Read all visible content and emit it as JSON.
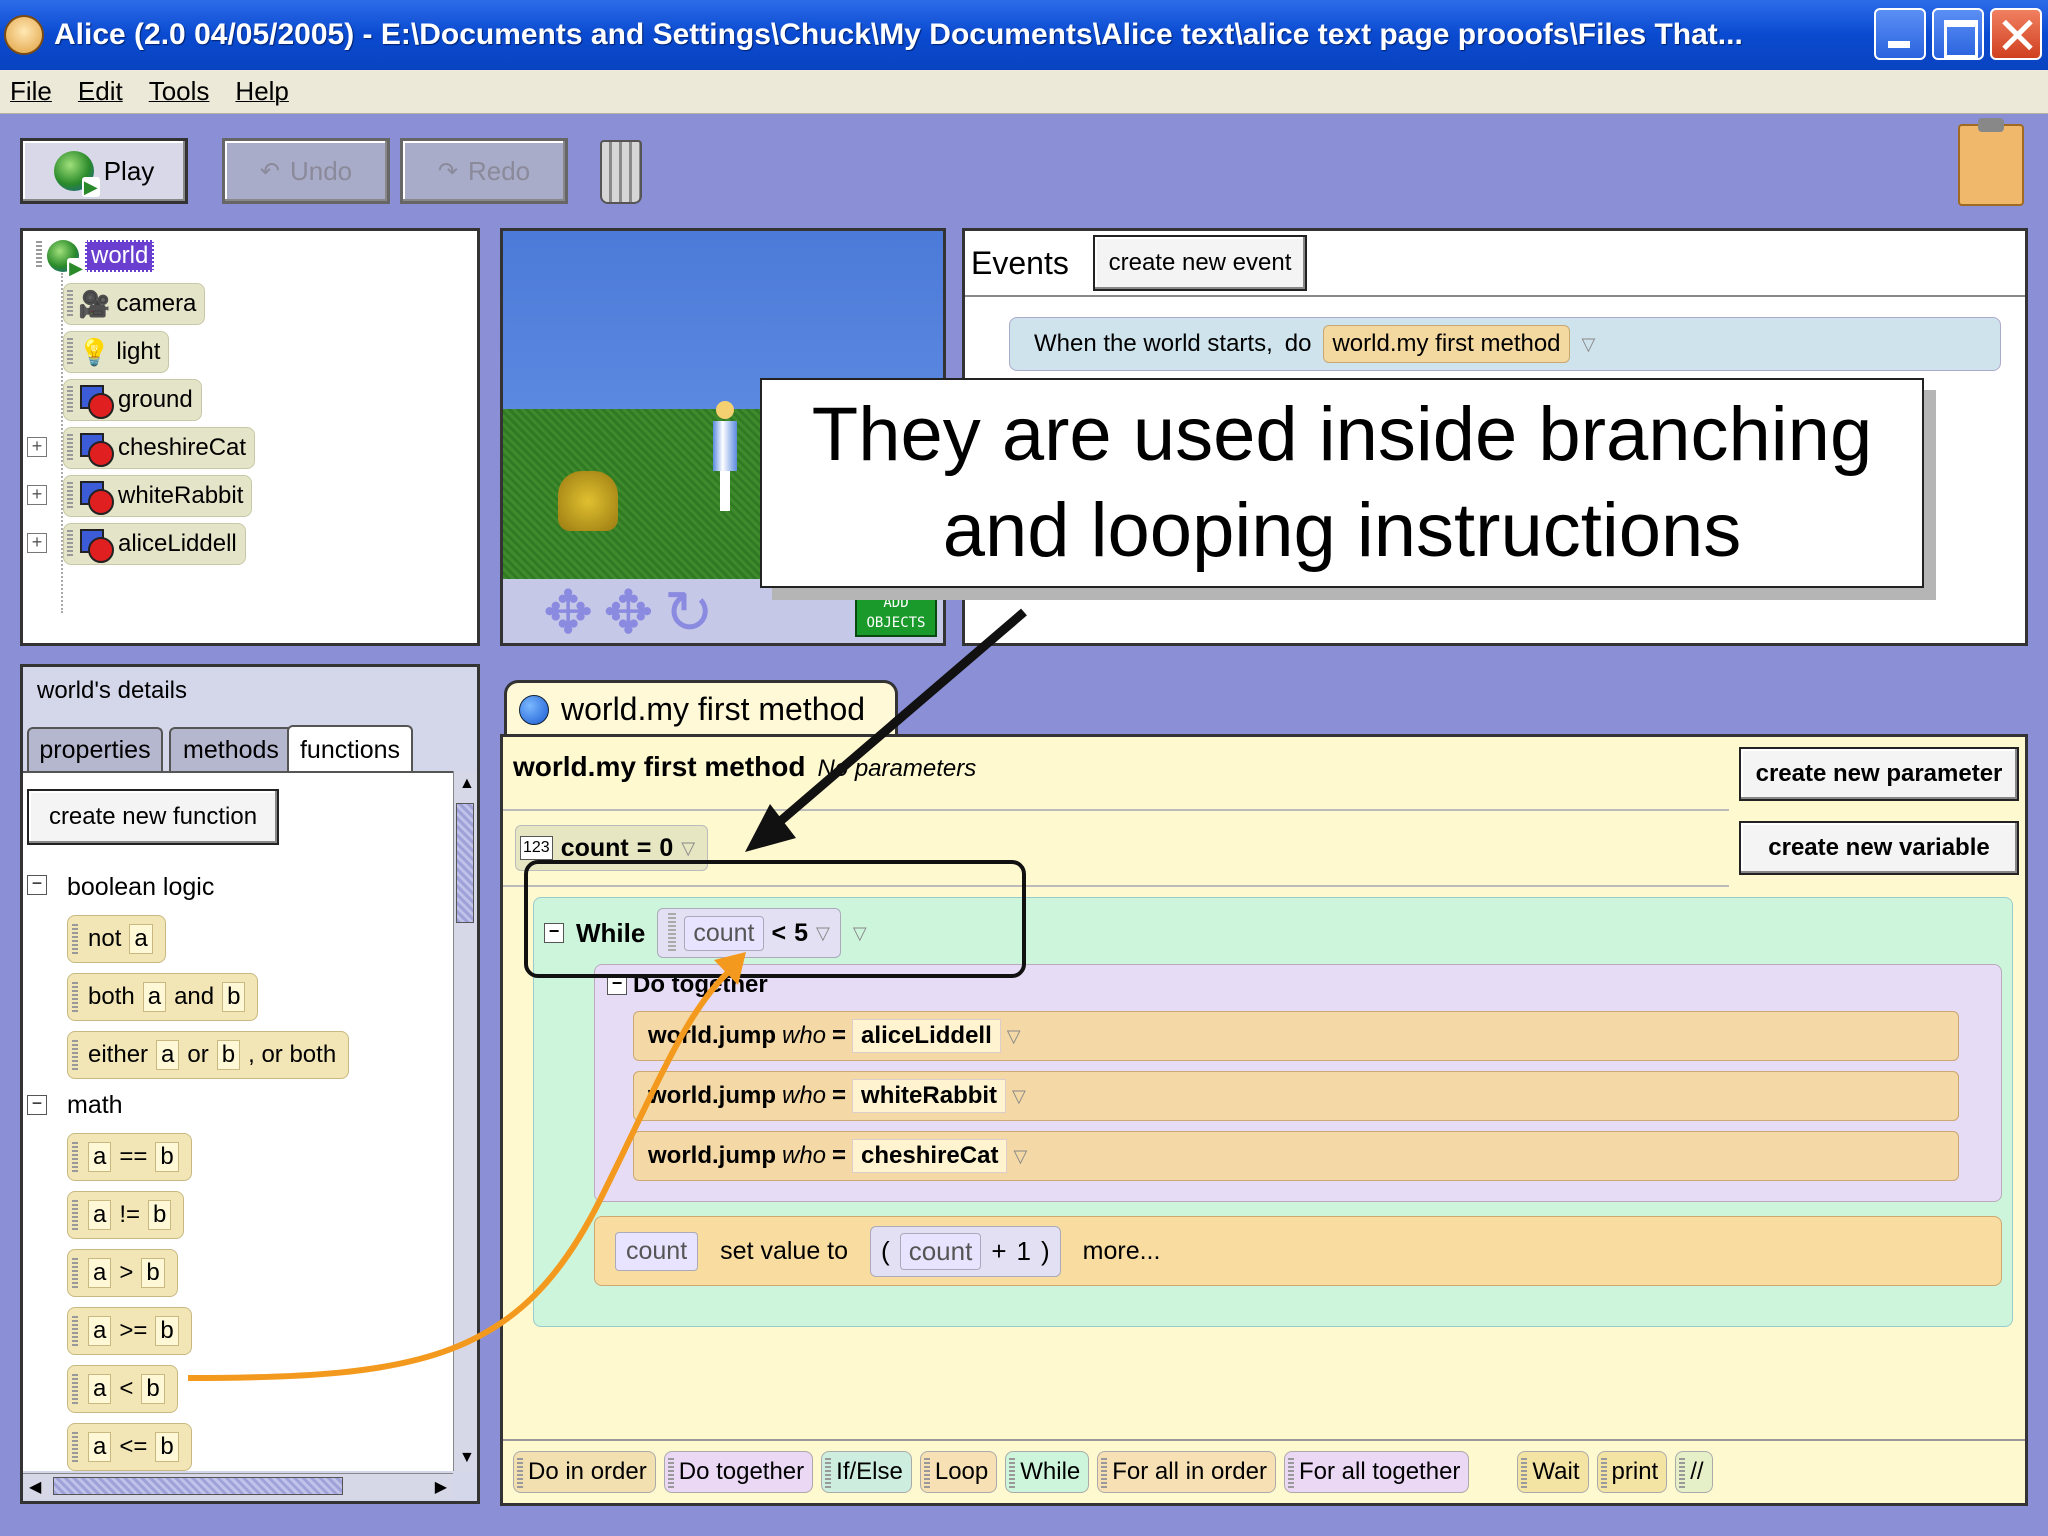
{
  "window": {
    "title": "Alice (2.0 04/05/2005) - E:\\Documents and Settings\\Chuck\\My Documents\\Alice text\\alice text page prooofs\\Files That..."
  },
  "menu": [
    "File",
    "Edit",
    "Tools",
    "Help"
  ],
  "toolbar": {
    "play": "Play",
    "undo": "Undo",
    "redo": "Redo"
  },
  "object_tree": [
    {
      "label": "world",
      "icon": "globe-icon",
      "selected": true
    },
    {
      "label": "camera",
      "icon": "camera-icon"
    },
    {
      "label": "light",
      "icon": "light-bulb-icon"
    },
    {
      "label": "ground",
      "icon": "object-icon"
    },
    {
      "label": "cheshireCat",
      "icon": "object-icon",
      "expandable": true
    },
    {
      "label": "whiteRabbit",
      "icon": "object-icon",
      "expandable": true
    },
    {
      "label": "aliceLiddell",
      "icon": "object-icon",
      "expandable": true
    }
  ],
  "scene": {
    "add_objects": "ADD OBJECTS"
  },
  "events": {
    "title": "Events",
    "create_button": "create new event",
    "rows": [
      {
        "trigger": "When the world starts,",
        "do": "do",
        "method": "world.my first method"
      }
    ]
  },
  "callout": {
    "line1": "They are used inside branching",
    "line2": "and looping instructions"
  },
  "details": {
    "title": "world's details",
    "tabs": [
      "properties",
      "methods",
      "functions"
    ],
    "active_tab": "functions",
    "create_button": "create new function",
    "categories": [
      {
        "name": "boolean logic",
        "items": [
          {
            "parts": [
              "not",
              "a"
            ]
          },
          {
            "parts": [
              "both",
              "a",
              "and",
              "b"
            ]
          },
          {
            "parts": [
              "either",
              "a",
              "or",
              "b",
              ", or both"
            ]
          }
        ]
      },
      {
        "name": "math",
        "items": [
          {
            "parts": [
              "a",
              "==",
              "b"
            ]
          },
          {
            "parts": [
              "a",
              "!=",
              "b"
            ]
          },
          {
            "parts": [
              "a",
              ">",
              "b"
            ]
          },
          {
            "parts": [
              "a",
              ">=",
              "b"
            ]
          },
          {
            "parts": [
              "a",
              "<",
              "b"
            ]
          },
          {
            "parts": [
              "a",
              "<=",
              "b"
            ]
          }
        ]
      }
    ]
  },
  "editor": {
    "tab_title": "world.my first method",
    "header_name": "world.my first method",
    "header_params": "No parameters",
    "create_parameter": "create new parameter",
    "create_variable": "create new variable",
    "variable": {
      "icon_text": "123",
      "name": "count",
      "eq": "=",
      "value": "0"
    },
    "while": {
      "label": "While",
      "var": "count",
      "op": "<",
      "value": "5"
    },
    "do_together": "Do together",
    "jumps": [
      {
        "call": "world.jump",
        "who": "who",
        "eq": "=",
        "target": "aliceLiddell"
      },
      {
        "call": "world.jump",
        "who": "who",
        "eq": "=",
        "target": "whiteRabbit"
      },
      {
        "call": "world.jump",
        "who": "who",
        "eq": "=",
        "target": "cheshireCat"
      }
    ],
    "set": {
      "var": "count",
      "text": "set  value to",
      "open": "(",
      "expr_var": "count",
      "plus": "+",
      "num": "1",
      "close": ")",
      "more": "more..."
    },
    "controls": [
      {
        "label": "Do in order",
        "color": "#f3e0b0"
      },
      {
        "label": "Do together",
        "color": "#ead8f4"
      },
      {
        "label": "If/Else",
        "color": "#cdeede"
      },
      {
        "label": "Loop",
        "color": "#f6e0b4"
      },
      {
        "label": "While",
        "color": "#cdf5dc"
      },
      {
        "label": "For all in order",
        "color": "#f6e0b4"
      },
      {
        "label": "For all together",
        "color": "#ead8f4"
      },
      {
        "label": "Wait",
        "color": "#f4e4a4"
      },
      {
        "label": "print",
        "color": "#f4e4a4"
      },
      {
        "label": "//",
        "color": "#e6f0c8"
      }
    ]
  },
  "colors": {
    "accent_arrow": "#f39a1e",
    "annotation": "#111111"
  }
}
